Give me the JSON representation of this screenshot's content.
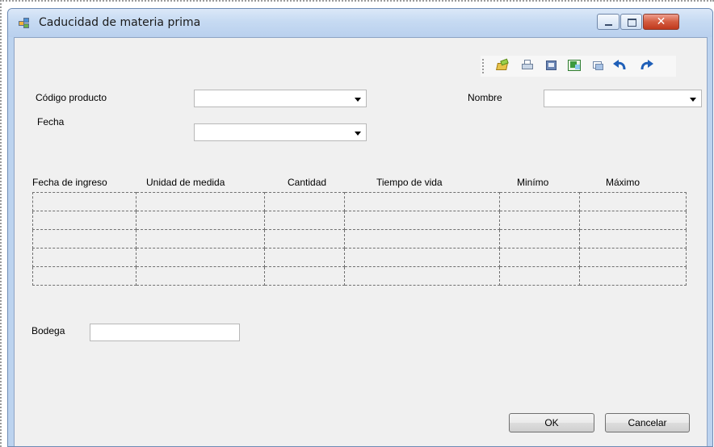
{
  "window": {
    "title": "Caducidad de materia prima",
    "controls": {
      "minimize": "minimize-icon",
      "maximize": "maximize-icon",
      "close": "close-icon"
    }
  },
  "toolbar": {
    "icons": [
      "open-folder-icon",
      "print-icon",
      "image-icon",
      "excel-export-icon",
      "copy-icon",
      "undo-icon",
      "redo-icon"
    ]
  },
  "form": {
    "codigo_label": "Código producto",
    "codigo_value": "",
    "nombre_label": "Nombre",
    "nombre_value": "",
    "fecha_label": "Fecha",
    "fecha_value": "",
    "bodega_label": "Bodega",
    "bodega_value": ""
  },
  "grid": {
    "columns": [
      "Fecha de ingreso",
      "Unidad de medida",
      "Cantidad",
      "Tiempo de vida",
      "Minímo",
      "Máximo"
    ],
    "row_count": 5
  },
  "buttons": {
    "ok": "OK",
    "cancel": "Cancelar"
  },
  "colors": {
    "titlebar": "#c6daf2",
    "client_bg": "#f0f0f0",
    "close_button": "#c0391d"
  }
}
